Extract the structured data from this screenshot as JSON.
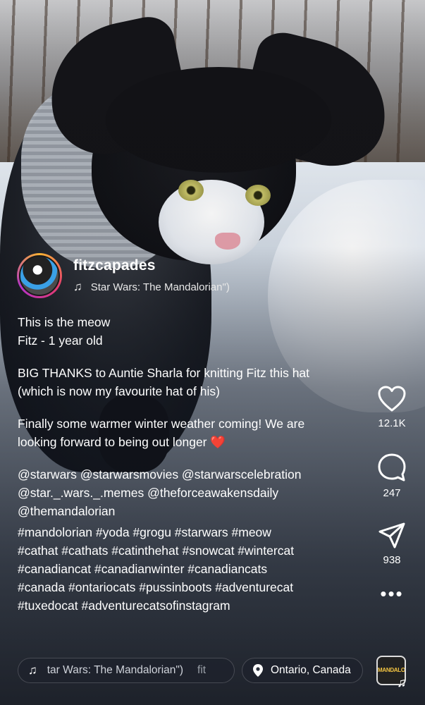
{
  "post": {
    "username": "fitzcapades",
    "audio_title": "Star Wars: The Mandalorian\")",
    "caption": {
      "line1": "This is the meow",
      "line2": "Fitz - 1 year old",
      "thanks1": "BIG THANKS to Auntie Sharla for knitting Fitz this hat",
      "thanks2": "(which is now my favourite hat of his)",
      "weather1": "Finally some warmer winter weather coming! We are",
      "weather2": "looking forward to being out longer",
      "heart_emoji": "❤️",
      "mentions": [
        "@starwars @starwarsmovies @starwarscelebration",
        "@star._.wars._.memes @theforceawakensdaily",
        "@themandalorian"
      ],
      "hashtags": [
        "#mandolorian #yoda #grogu #starwars #meow",
        "#cathat #cathats #catinthehat #snowcat #wintercat",
        "#canadiancat #canadianwinter #canadiancats",
        "#canada #ontariocats #pussinboots #adventurecat",
        "#tuxedocat #adventurecatsofinstagram"
      ]
    }
  },
  "actions": {
    "likes": "12.1K",
    "comments": "247",
    "shares": "938",
    "more": "•••"
  },
  "bottom_bar": {
    "audio_pill": "tar Wars: The Mandalorian\")",
    "audio_extra": "fit",
    "location_pill": "Ontario, Canada",
    "audio_thumb_text": "MANDALORIAN"
  },
  "icons": {
    "music": "music-note-icon",
    "heart": "heart-icon",
    "comment": "comment-icon",
    "share": "send-icon",
    "location": "location-pin-icon",
    "more": "more-icon"
  }
}
